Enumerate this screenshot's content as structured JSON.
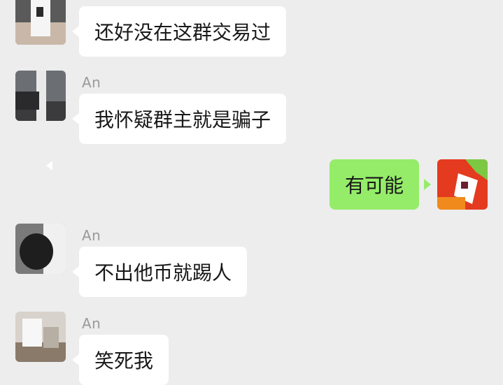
{
  "chat": {
    "messages": [
      {
        "direction": "incoming",
        "sender": "",
        "text": "还好没在这群交易过",
        "avatar": "avatar-incoming-icon"
      },
      {
        "direction": "incoming",
        "sender": "An",
        "text": "我怀疑群主就是骗子",
        "avatar": "avatar-incoming-icon"
      },
      {
        "direction": "outgoing",
        "sender": "",
        "text": "有可能",
        "avatar": "avatar-outgoing-icon"
      },
      {
        "direction": "incoming",
        "sender": "An",
        "text": "不出他币就踢人",
        "avatar": "avatar-incoming-icon"
      },
      {
        "direction": "incoming",
        "sender": "An",
        "text": "笑死我",
        "avatar": "avatar-incoming-icon"
      }
    ]
  },
  "colors": {
    "background": "#ededed",
    "incoming_bubble": "#ffffff",
    "outgoing_bubble": "#95ec69",
    "sender_name": "#9a9a9a",
    "message_text": "#181818"
  }
}
